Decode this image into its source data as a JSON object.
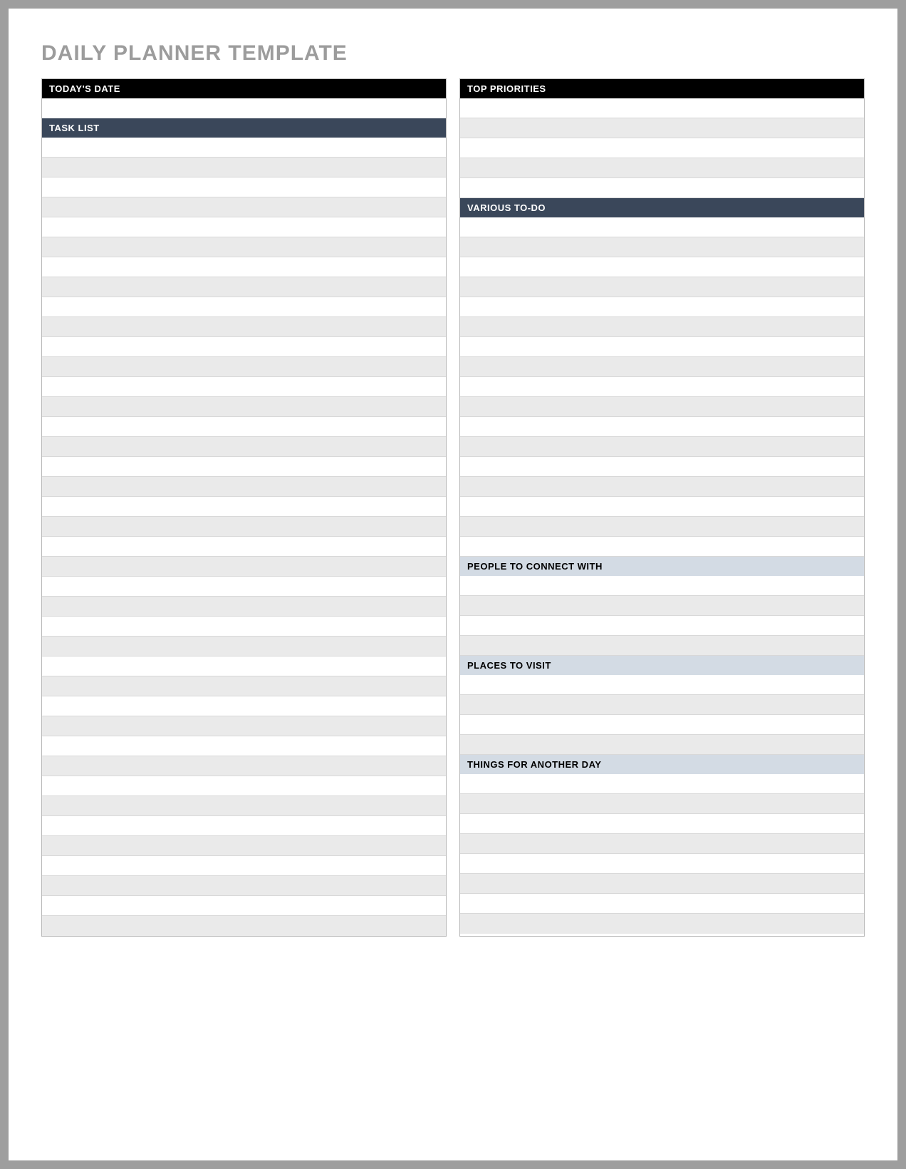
{
  "title": "DAILY PLANNER TEMPLATE",
  "todaysDate": {
    "label": "TODAY'S DATE"
  },
  "taskList": {
    "label": "TASK LIST"
  },
  "topPriorities": {
    "label": "TOP PRIORITIES"
  },
  "variousTodo": {
    "label": "VARIOUS TO-DO"
  },
  "peopleToConnect": {
    "label": "PEOPLE TO CONNECT WITH"
  },
  "placesToVisit": {
    "label": "PLACES TO VISIT"
  },
  "thingsForAnotherDay": {
    "label": "THINGS FOR ANOTHER DAY"
  }
}
